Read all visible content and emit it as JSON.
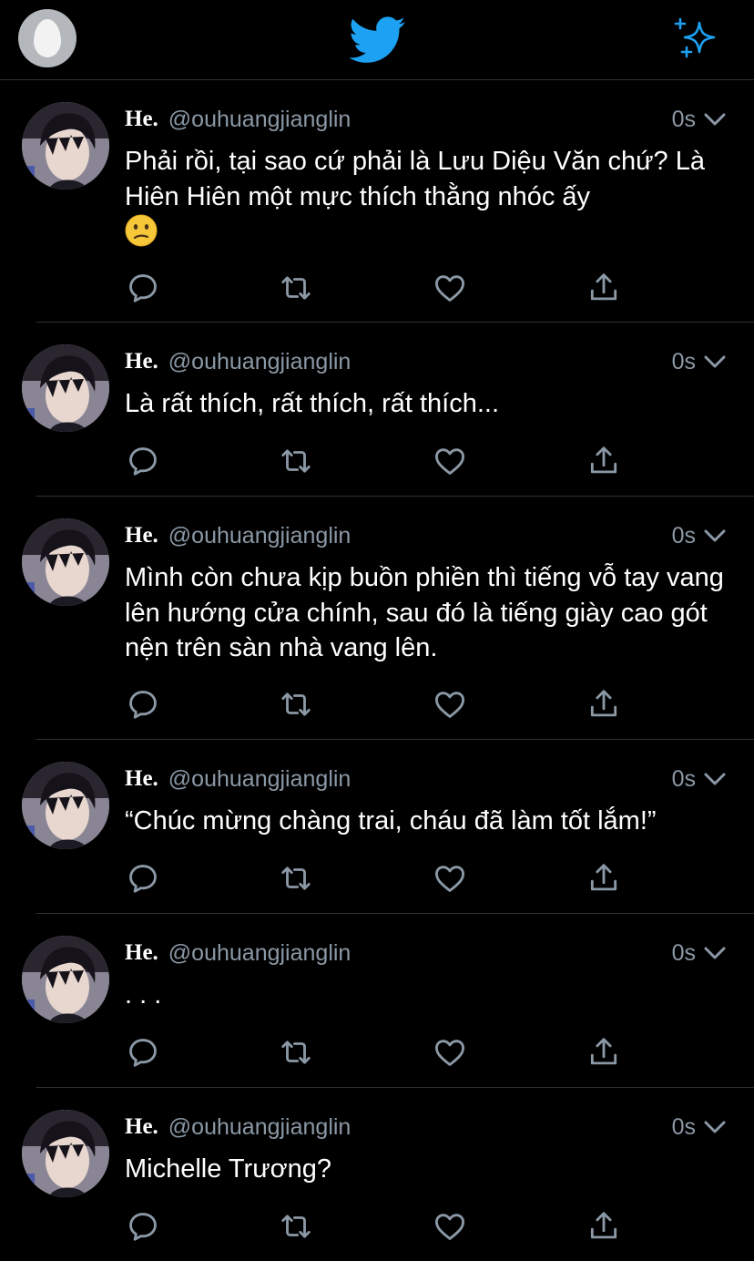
{
  "header": {
    "profile_icon": "profile-egg-icon",
    "logo_icon": "twitter-bird-icon",
    "sparkle_icon": "sparkle-icon",
    "accent_color": "#1da1f2"
  },
  "colors": {
    "background": "#000000",
    "text_primary": "#ffffff",
    "text_secondary": "#8b98a5",
    "divider": "#2f3336"
  },
  "tweets": [
    {
      "name": "He.",
      "handle": "@ouhuangjianglin",
      "time": "0s",
      "text": "Phải rồi, tại sao cứ phải là Lưu Diệu Văn chứ? Là Hiên Hiên một mực thích thằng nhóc ấy",
      "emoji": "confused-face-emoji"
    },
    {
      "name": "He.",
      "handle": "@ouhuangjianglin",
      "time": "0s",
      "text": "Là rất thích, rất thích, rất thích..."
    },
    {
      "name": "He.",
      "handle": "@ouhuangjianglin",
      "time": "0s",
      "text": "Mình còn chưa kịp buồn phiền thì tiếng vỗ tay vang lên hướng cửa chính, sau đó là tiếng giày cao gót nện trên sàn nhà vang lên."
    },
    {
      "name": "He.",
      "handle": "@ouhuangjianglin",
      "time": "0s",
      "text": "“Chúc mừng chàng trai, cháu đã làm tốt lắm!”"
    },
    {
      "name": "He.",
      "handle": "@ouhuangjianglin",
      "time": "0s",
      "text": ". . ."
    },
    {
      "name": "He.",
      "handle": "@ouhuangjianglin",
      "time": "0s",
      "text": "Michelle Trương?"
    }
  ]
}
